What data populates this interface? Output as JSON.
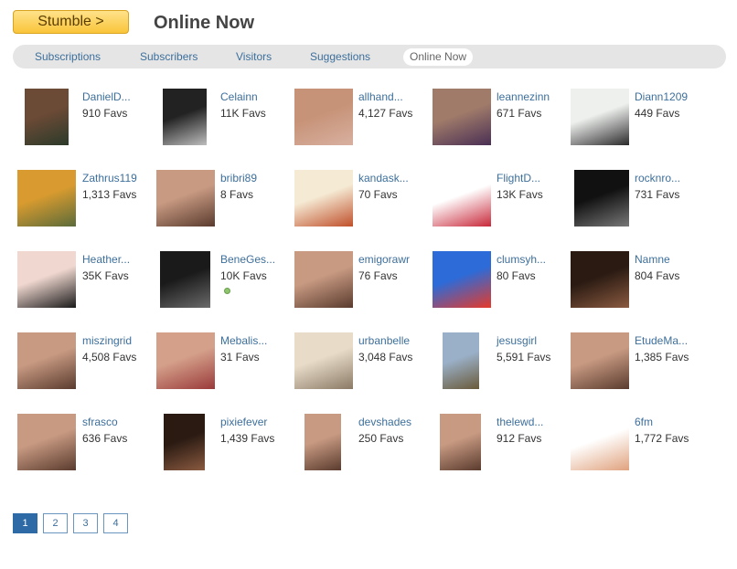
{
  "header": {
    "stumble_label": "Stumble >",
    "title": "Online Now"
  },
  "tabs": [
    {
      "label": "Subscriptions",
      "active": false
    },
    {
      "label": "Subscribers",
      "active": false
    },
    {
      "label": "Visitors",
      "active": false
    },
    {
      "label": "Suggestions",
      "active": false
    },
    {
      "label": "Online Now",
      "active": true
    }
  ],
  "users": [
    {
      "name": "DanielD...",
      "favs": "910 Favs",
      "avatar": "man-portrait"
    },
    {
      "name": "Celainn",
      "favs": "11K Favs",
      "avatar": "bw-concert-photo"
    },
    {
      "name": "allhand...",
      "favs": "4,127 Favs",
      "avatar": "older-man-portrait"
    },
    {
      "name": "leannezinn",
      "favs": "671 Favs",
      "avatar": "woman-photo"
    },
    {
      "name": "Diann1209",
      "favs": "449 Favs",
      "avatar": "lighthouse-photo"
    },
    {
      "name": "Zathrus119",
      "favs": "1,313 Favs",
      "avatar": "cartoon-cat"
    },
    {
      "name": "bribri89",
      "favs": "8 Favs",
      "avatar": "woman-portrait"
    },
    {
      "name": "kandask...",
      "favs": "70 Favs",
      "avatar": "bird-branch-art"
    },
    {
      "name": "FlightD...",
      "favs": "13K Favs",
      "avatar": "eagle-flag-art"
    },
    {
      "name": "rocknro...",
      "favs": "731 Favs",
      "avatar": "bw-guitar-text"
    },
    {
      "name": "Heather...",
      "favs": "35K Favs",
      "avatar": "face-art"
    },
    {
      "name": "BeneGes...",
      "favs": "10K Favs",
      "avatar": "muppet-figure",
      "online": true
    },
    {
      "name": "emigorawr",
      "favs": "76 Favs",
      "avatar": "woman-portrait"
    },
    {
      "name": "clumsyh...",
      "favs": "80 Favs",
      "avatar": "pop-art-grid"
    },
    {
      "name": "Namne",
      "favs": "804 Favs",
      "avatar": "woman-dark-portrait"
    },
    {
      "name": "miszingrid",
      "favs": "4,508 Favs",
      "avatar": "woman-portrait"
    },
    {
      "name": "Mebalis...",
      "favs": "31 Favs",
      "avatar": "face-paint-portrait"
    },
    {
      "name": "urbanbelle",
      "favs": "3,048 Favs",
      "avatar": "sepia-portrait"
    },
    {
      "name": "jesusgirl",
      "favs": "5,591 Favs",
      "avatar": "field-landscape"
    },
    {
      "name": "EtudeMa...",
      "favs": "1,385 Favs",
      "avatar": "woman-portrait"
    },
    {
      "name": "sfrasco",
      "favs": "636 Favs",
      "avatar": "woman-portrait"
    },
    {
      "name": "pixiefever",
      "favs": "1,439 Favs",
      "avatar": "woman-dark-portrait"
    },
    {
      "name": "devshades",
      "favs": "250 Favs",
      "avatar": "woman-portrait"
    },
    {
      "name": "thelewd...",
      "favs": "912 Favs",
      "avatar": "woman-portrait"
    },
    {
      "name": "6fm",
      "favs": "1,772 Favs",
      "avatar": "hand-gesture-art"
    }
  ],
  "pagination": {
    "pages": [
      "1",
      "2",
      "3",
      "4"
    ],
    "current": "1"
  },
  "colors": {
    "link": "#3d6f9b",
    "stumble_button": "#f9c53a",
    "current_page": "#2e6aa5",
    "online_dot": "#8cc56b"
  }
}
